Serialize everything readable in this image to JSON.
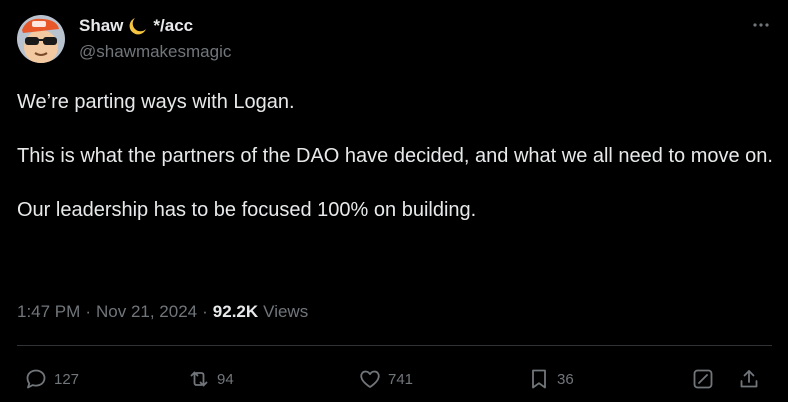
{
  "author": {
    "name": "Shaw",
    "suffix": "*/acc",
    "handle": "@shawmakesmagic"
  },
  "tweet": {
    "paragraphs": [
      "We’re parting ways with Logan.",
      "This is what the partners of the DAO have decided, and what we all need to move on.",
      "Our leadership has to be focused 100% on building."
    ]
  },
  "meta": {
    "time": "1:47 PM",
    "separator": "·",
    "date": "Nov 21, 2024",
    "views_count": "92.2K",
    "views_label": "Views"
  },
  "actions": {
    "replies": "127",
    "reposts": "94",
    "likes": "741",
    "bookmarks": "36"
  },
  "colors": {
    "background": "#000000",
    "text": "#e7e9ea",
    "secondary": "#71767b",
    "divider": "#2f3336"
  }
}
